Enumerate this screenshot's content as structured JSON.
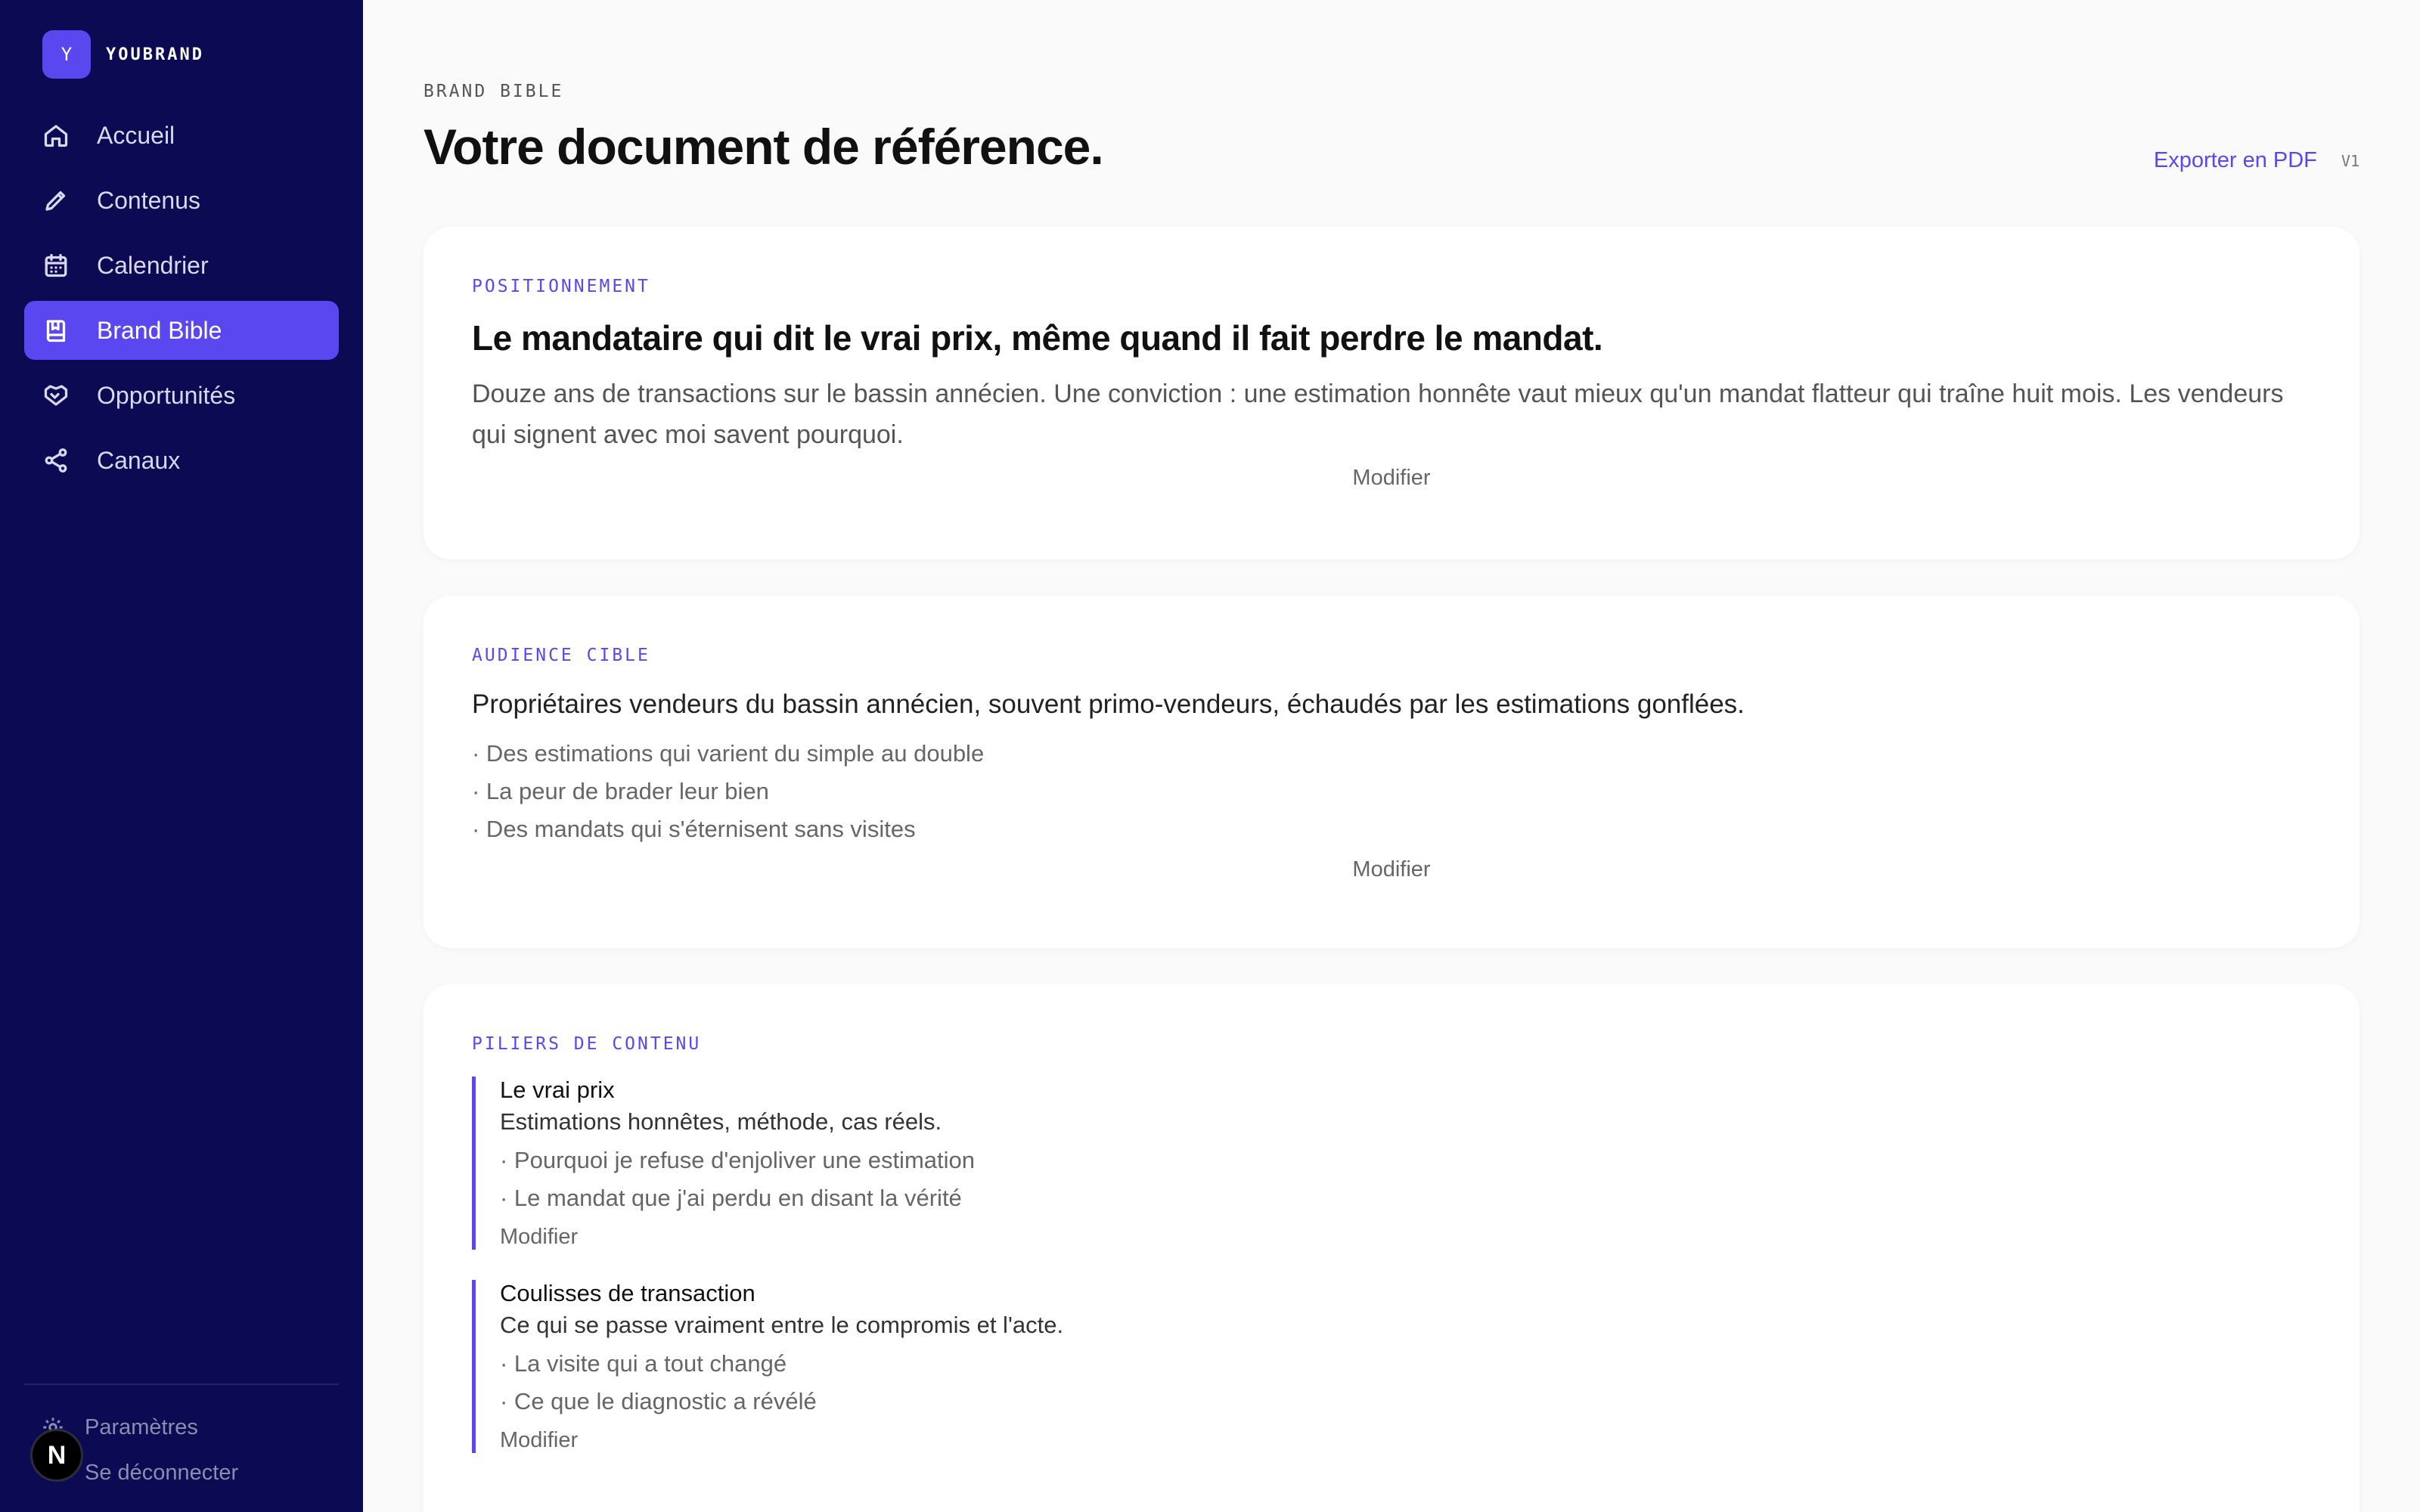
{
  "sidebar": {
    "brand_initial": "Y",
    "brand_name": "YOUBRAND",
    "items": [
      {
        "label": "Accueil",
        "icon": "home-icon"
      },
      {
        "label": "Contenus",
        "icon": "pen-icon"
      },
      {
        "label": "Calendrier",
        "icon": "calendar-icon"
      },
      {
        "label": "Brand Bible",
        "icon": "book-icon",
        "active": true
      },
      {
        "label": "Opportunités",
        "icon": "handshake-icon"
      },
      {
        "label": "Canaux",
        "icon": "share-icon"
      }
    ],
    "settings_label": "Paramètres",
    "logout_label": "Se déconnecter",
    "badge_letter": "N"
  },
  "header": {
    "eyebrow": "BRAND BIBLE",
    "title": "Votre document de référence.",
    "export_label": "Exporter en PDF",
    "version": "V1"
  },
  "positioning": {
    "label": "POSITIONNEMENT",
    "headline": "Le mandataire qui dit le vrai prix, même quand il fait perdre le mandat.",
    "text": "Douze ans de transactions sur le bassin annécien. Une conviction : une estimation honnête vaut mieux qu'un mandat flatteur qui traîne huit mois. Les vendeurs qui signent avec moi savent pourquoi.",
    "modify_label": "Modifier"
  },
  "audience": {
    "label": "AUDIENCE CIBLE",
    "lead": "Propriétaires vendeurs du bassin annécien, souvent primo-vendeurs, échaudés par les estimations gonflées.",
    "pains": [
      "· Des estimations qui varient du simple au double",
      "· La peur de brader leur bien",
      "· Des mandats qui s'éternisent sans visites"
    ],
    "modify_label": "Modifier"
  },
  "pillars": {
    "label": "PILIERS DE CONTENU",
    "items": [
      {
        "title": "Le vrai prix",
        "desc": "Estimations honnêtes, méthode, cas réels.",
        "ideas": [
          "· Pourquoi je refuse d'enjoliver une estimation",
          "· Le mandat que j'ai perdu en disant la vérité"
        ],
        "modify_label": "Modifier"
      },
      {
        "title": "Coulisses de transaction",
        "desc": "Ce qui se passe vraiment entre le compromis et l'acte.",
        "ideas": [
          "· La visite qui a tout changé",
          "· Ce que le diagnostic a révélé"
        ],
        "modify_label": "Modifier"
      }
    ]
  },
  "colors": {
    "sidebar_bg": "#0b0a52",
    "accent": "#5b47f0",
    "page_bg": "#fafafa"
  }
}
